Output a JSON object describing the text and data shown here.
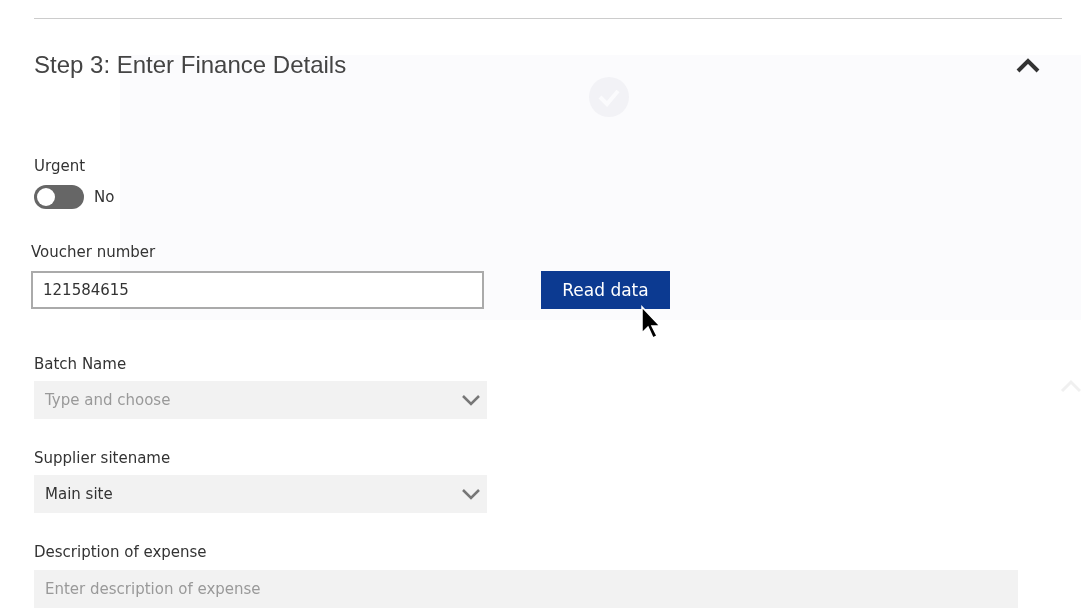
{
  "section": {
    "title": "Step 3: Enter Finance Details",
    "expanded": true
  },
  "urgent": {
    "label": "Urgent",
    "on": false,
    "state_text": "No"
  },
  "voucher": {
    "label": "Voucher number",
    "value": "121584615",
    "button": "Read data"
  },
  "fields": [
    {
      "label": "Batch Name",
      "kind": "dropdown",
      "placeholder": "Type and choose"
    },
    {
      "label": "Supplier sitename",
      "kind": "dropdown",
      "value": "Main site"
    },
    {
      "label": "Description of expense",
      "kind": "text",
      "placeholder": "Enter description of expense"
    }
  ]
}
